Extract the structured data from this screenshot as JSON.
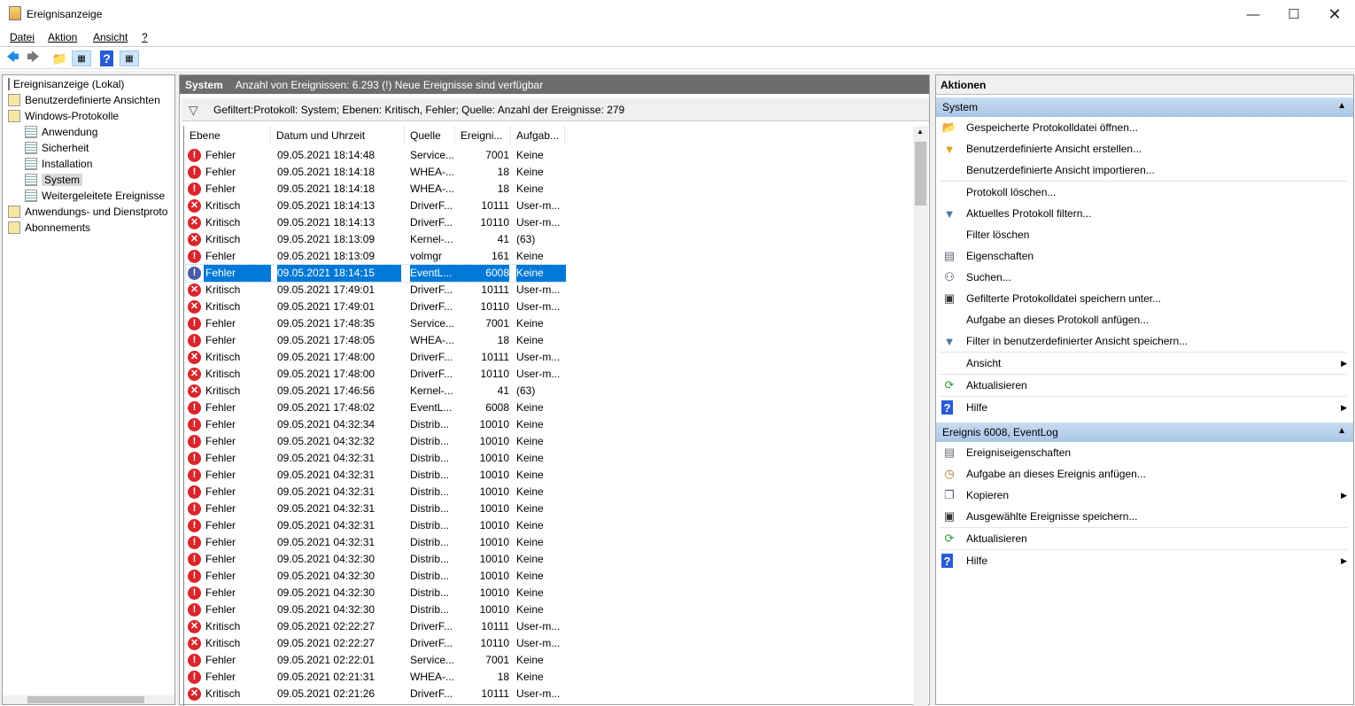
{
  "window": {
    "title": "Ereignisanzeige"
  },
  "menu": [
    "Datei",
    "Aktion",
    "Ansicht",
    "?"
  ],
  "toolbar": [
    "back-icon",
    "forward-icon",
    "up-folder-icon",
    "show-hide-tree-icon",
    "help-icon",
    "show-hide-action-pane-icon"
  ],
  "tree": {
    "items": [
      {
        "label": "Ereignisanzeige (Lokal)",
        "level": 0,
        "icon": "event-viewer-icon"
      },
      {
        "label": "Benutzerdefinierte Ansichten",
        "level": 1,
        "icon": "folder-icon"
      },
      {
        "label": "Windows-Protokolle",
        "level": 1,
        "icon": "folder-icon"
      },
      {
        "label": "Anwendung",
        "level": 2,
        "icon": "log-icon"
      },
      {
        "label": "Sicherheit",
        "level": 2,
        "icon": "log-icon"
      },
      {
        "label": "Installation",
        "level": 2,
        "icon": "log-icon"
      },
      {
        "label": "System",
        "level": 2,
        "icon": "log-icon",
        "selected": true
      },
      {
        "label": "Weitergeleitete Ereignisse",
        "level": 2,
        "icon": "log-icon"
      },
      {
        "label": "Anwendungs- und Dienstproto",
        "level": 1,
        "icon": "folder-icon"
      },
      {
        "label": "Abonnements",
        "level": 1,
        "icon": "folder-icon"
      }
    ]
  },
  "center": {
    "title": "System",
    "info": "Anzahl von Ereignissen: 6.293 (!) Neue Ereignisse sind verfügbar",
    "filter": "Gefiltert:Protokoll: System; Ebenen: Kritisch, Fehler; Quelle:  Anzahl der Ereignisse: 279",
    "columns": [
      "Ebene",
      "Datum und Uhrzeit",
      "Quelle",
      "Ereigni...",
      "Aufgab..."
    ],
    "rows": [
      [
        "Fehler",
        "09.05.2021 18:14:48",
        "Service...",
        "7001",
        "Keine"
      ],
      [
        "Fehler",
        "09.05.2021 18:14:18",
        "WHEA-...",
        "18",
        "Keine"
      ],
      [
        "Fehler",
        "09.05.2021 18:14:18",
        "WHEA-...",
        "18",
        "Keine"
      ],
      [
        "Kritisch",
        "09.05.2021 18:14:13",
        "DriverF...",
        "10111",
        "User-m..."
      ],
      [
        "Kritisch",
        "09.05.2021 18:14:13",
        "DriverF...",
        "10110",
        "User-m..."
      ],
      [
        "Kritisch",
        "09.05.2021 18:13:09",
        "Kernel-...",
        "41",
        "(63)"
      ],
      [
        "Fehler",
        "09.05.2021 18:13:09",
        "volmgr",
        "161",
        "Keine"
      ],
      [
        "Fehler",
        "09.05.2021 18:14:15",
        "EventL...",
        "6008",
        "Keine"
      ],
      [
        "Kritisch",
        "09.05.2021 17:49:01",
        "DriverF...",
        "10111",
        "User-m..."
      ],
      [
        "Kritisch",
        "09.05.2021 17:49:01",
        "DriverF...",
        "10110",
        "User-m..."
      ],
      [
        "Fehler",
        "09.05.2021 17:48:35",
        "Service...",
        "7001",
        "Keine"
      ],
      [
        "Fehler",
        "09.05.2021 17:48:05",
        "WHEA-...",
        "18",
        "Keine"
      ],
      [
        "Kritisch",
        "09.05.2021 17:48:00",
        "DriverF...",
        "10111",
        "User-m..."
      ],
      [
        "Kritisch",
        "09.05.2021 17:48:00",
        "DriverF...",
        "10110",
        "User-m..."
      ],
      [
        "Kritisch",
        "09.05.2021 17:46:56",
        "Kernel-...",
        "41",
        "(63)"
      ],
      [
        "Fehler",
        "09.05.2021 17:48:02",
        "EventL...",
        "6008",
        "Keine"
      ],
      [
        "Fehler",
        "09.05.2021 04:32:34",
        "Distrib...",
        "10010",
        "Keine"
      ],
      [
        "Fehler",
        "09.05.2021 04:32:32",
        "Distrib...",
        "10010",
        "Keine"
      ],
      [
        "Fehler",
        "09.05.2021 04:32:31",
        "Distrib...",
        "10010",
        "Keine"
      ],
      [
        "Fehler",
        "09.05.2021 04:32:31",
        "Distrib...",
        "10010",
        "Keine"
      ],
      [
        "Fehler",
        "09.05.2021 04:32:31",
        "Distrib...",
        "10010",
        "Keine"
      ],
      [
        "Fehler",
        "09.05.2021 04:32:31",
        "Distrib...",
        "10010",
        "Keine"
      ],
      [
        "Fehler",
        "09.05.2021 04:32:31",
        "Distrib...",
        "10010",
        "Keine"
      ],
      [
        "Fehler",
        "09.05.2021 04:32:31",
        "Distrib...",
        "10010",
        "Keine"
      ],
      [
        "Fehler",
        "09.05.2021 04:32:30",
        "Distrib...",
        "10010",
        "Keine"
      ],
      [
        "Fehler",
        "09.05.2021 04:32:30",
        "Distrib...",
        "10010",
        "Keine"
      ],
      [
        "Fehler",
        "09.05.2021 04:32:30",
        "Distrib...",
        "10010",
        "Keine"
      ],
      [
        "Fehler",
        "09.05.2021 04:32:30",
        "Distrib...",
        "10010",
        "Keine"
      ],
      [
        "Kritisch",
        "09.05.2021 02:22:27",
        "DriverF...",
        "10111",
        "User-m..."
      ],
      [
        "Kritisch",
        "09.05.2021 02:22:27",
        "DriverF...",
        "10110",
        "User-m..."
      ],
      [
        "Fehler",
        "09.05.2021 02:22:01",
        "Service...",
        "7001",
        "Keine"
      ],
      [
        "Fehler",
        "09.05.2021 02:21:31",
        "WHEA-...",
        "18",
        "Keine"
      ],
      [
        "Kritisch",
        "09.05.2021 02:21:26",
        "DriverF...",
        "10111",
        "User-m..."
      ]
    ],
    "selected_row": 7
  },
  "actions": {
    "title": "Aktionen",
    "sections": [
      {
        "title": "System",
        "items": [
          {
            "label": "Gespeicherte Protokolldatei öffnen...",
            "icon": "open-folder-icon"
          },
          {
            "label": "Benutzerdefinierte Ansicht erstellen...",
            "icon": "create-filter-icon"
          },
          {
            "label": "Benutzerdefinierte Ansicht importieren...",
            "icon": "",
            "sep": true
          },
          {
            "label": "Protokoll löschen...",
            "icon": ""
          },
          {
            "label": "Aktuelles Protokoll filtern...",
            "icon": "filter-icon"
          },
          {
            "label": "Filter löschen",
            "icon": ""
          },
          {
            "label": "Eigenschaften",
            "icon": "properties-icon"
          },
          {
            "label": "Suchen...",
            "icon": "binoculars-icon"
          },
          {
            "label": "Gefilterte Protokolldatei speichern unter...",
            "icon": "save-icon"
          },
          {
            "label": "Aufgabe an dieses Protokoll anfügen...",
            "icon": ""
          },
          {
            "label": "Filter in benutzerdefinierter Ansicht speichern...",
            "icon": "save-filter-icon",
            "sep": true
          },
          {
            "label": "Ansicht",
            "icon": "",
            "submenu": true,
            "sep": true
          },
          {
            "label": "Aktualisieren",
            "icon": "refresh-icon",
            "sep": true
          },
          {
            "label": "Hilfe",
            "icon": "help-icon",
            "submenu": true
          }
        ]
      },
      {
        "title": "Ereignis 6008, EventLog",
        "items": [
          {
            "label": "Ereigniseigenschaften",
            "icon": "properties-icon"
          },
          {
            "label": "Aufgabe an dieses Ereignis anfügen...",
            "icon": "task-icon"
          },
          {
            "label": "Kopieren",
            "icon": "copy-icon",
            "submenu": true
          },
          {
            "label": "Ausgewählte Ereignisse speichern...",
            "icon": "save-icon",
            "sep": true
          },
          {
            "label": "Aktualisieren",
            "icon": "refresh-icon",
            "sep": true
          },
          {
            "label": "Hilfe",
            "icon": "help-icon",
            "submenu": true
          }
        ]
      }
    ]
  },
  "colors": {
    "error": "#d9262b",
    "selection": "#0078d7",
    "header_bar": "#6d6d6d",
    "section_header": "#b9d1ec"
  }
}
